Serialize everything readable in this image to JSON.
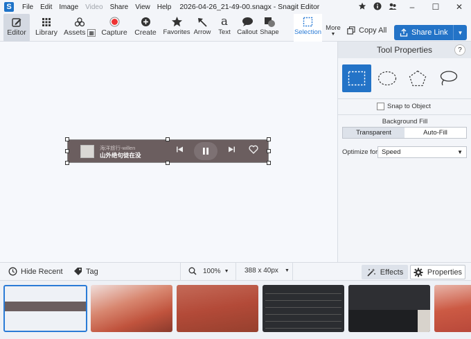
{
  "window": {
    "app_logo": "S",
    "title": "2026-04-26_21-49-00.snagx - Snagit Editor",
    "menu": [
      "File",
      "Edit",
      "Image",
      "Video",
      "Share",
      "View",
      "Help"
    ],
    "disabled_menu": "Video",
    "title_icons": [
      "star-icon",
      "info-icon",
      "account-icon"
    ],
    "window_controls": [
      "–",
      "☐",
      "✕"
    ]
  },
  "toolbar": {
    "editor": "Editor",
    "library": "Library",
    "assets": "Assets",
    "capture": "Capture",
    "create": "Create",
    "favorites": "Favorites",
    "arrow": "Arrow",
    "text": "Text",
    "callout": "Callout",
    "shape": "Shape",
    "selection": "Selection",
    "more": "More",
    "copy_all": "Copy All",
    "share_link": "Share Link"
  },
  "capture": {
    "line1": "海洋旅行-willen",
    "line2": "山外绝句徒在没"
  },
  "panel": {
    "title": "Tool Properties",
    "help": "?",
    "snap_label": "Snap to Object",
    "bg_fill_label": "Background Fill",
    "transparent": "Transparent",
    "auto_fill": "Auto-Fill",
    "optimize_label": "Optimize for",
    "optimize_value": "Speed"
  },
  "bottom": {
    "hide_recent": "Hide Recent",
    "tag": "Tag",
    "zoom": "100%",
    "size": "388 x 40px",
    "effects": "Effects",
    "properties": "Properties"
  },
  "colors": {
    "accent": "#2373c7",
    "capture_bg": "#6b5e5f"
  }
}
